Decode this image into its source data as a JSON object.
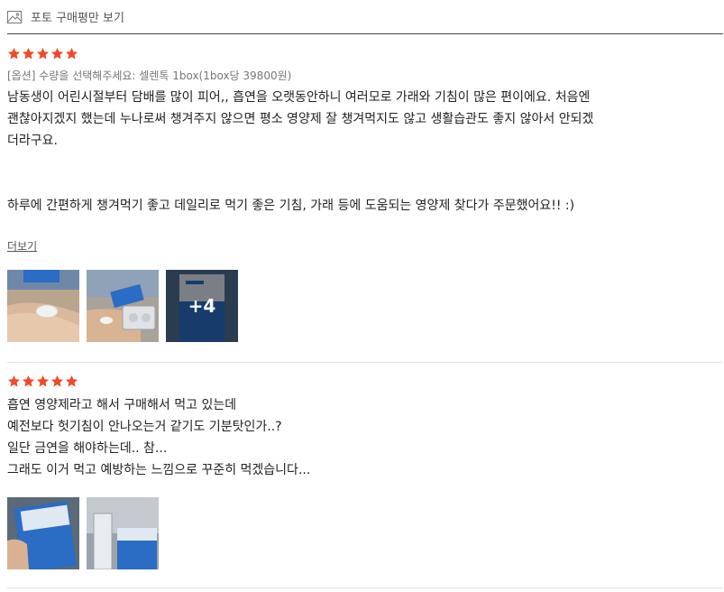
{
  "filter": {
    "label": "포토 구매평만 보기",
    "icon": "image-icon"
  },
  "colors": {
    "star": "#f04a2a",
    "divider": "#e2e2e2",
    "accent_blue": "#2b6cc4"
  },
  "reviews": [
    {
      "rating": 5,
      "option": "[옵션] 수량을 선택해주세요: 셀렌톡 1box(1box당 39800원)",
      "lines": [
        "남동생이 어린시절부터 담배를 많이 피어,, 흡연을 오랫동안하니 여러모로 가래와 기침이 많은 편이에요. 처음엔",
        "괜찮아지겠지 했는데 누나로써 챙겨주지 않으면 평소 영양제 잘 챙겨먹지도 않고 생활습관도 좋지 않아서 안되겠",
        "더라구요."
      ],
      "lines_after": [
        "하루에 간편하게 챙겨먹기 좋고 데일리로 먹기 좋은 기침, 가래 등에 도움되는 영양제 찾다가 주문했어요!! :)"
      ],
      "more_label": "더보기",
      "more_photos": "+4"
    },
    {
      "rating": 5,
      "lines": [
        "흡연 영양제라고 해서 구매해서 먹고 있는데",
        "예전보다 헛기침이 안나오는거 같기도 기분탓인가..?",
        "일단 금연을 해야하는데.. 참...",
        "그래도 이거 먹고 예방하는 느낌으로 꾸준히 먹겠습니다..."
      ]
    }
  ]
}
